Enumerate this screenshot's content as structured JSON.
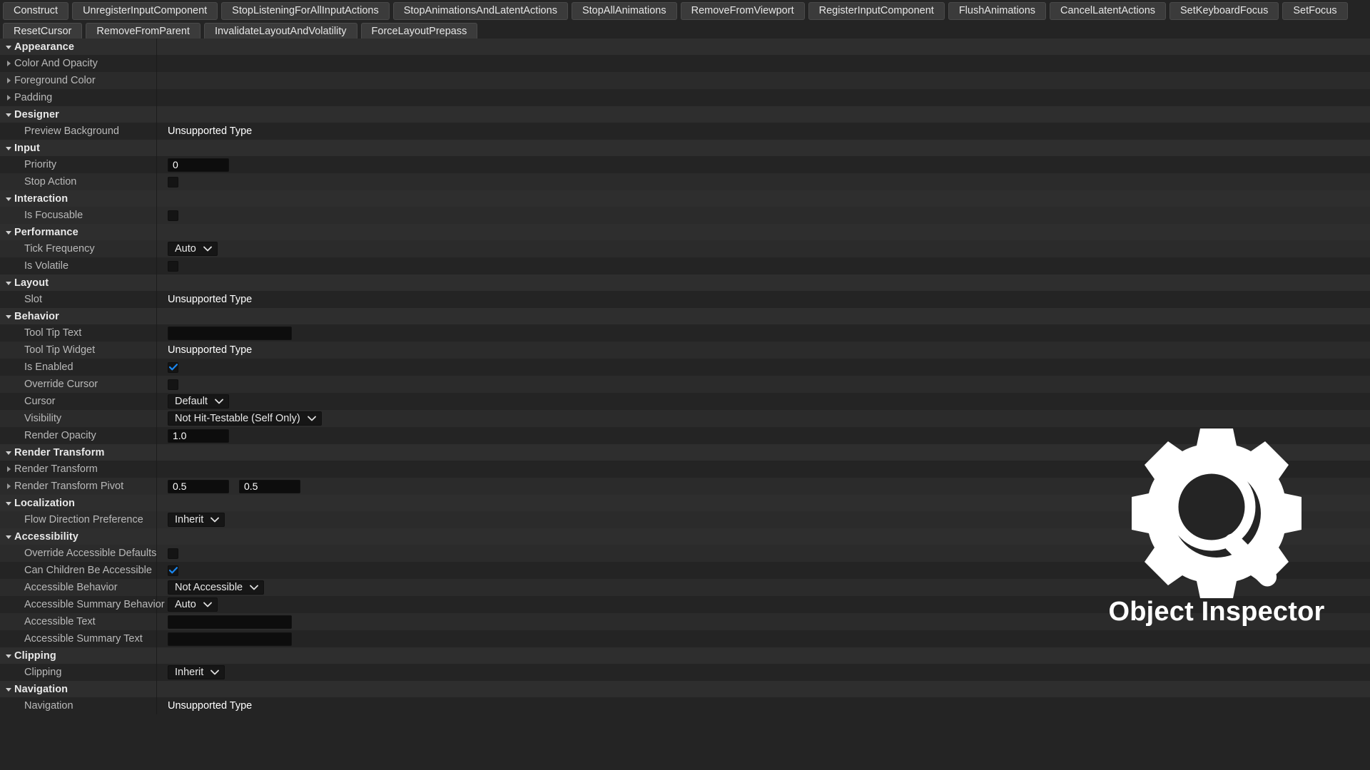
{
  "toolbar": {
    "buttons": [
      "Construct",
      "UnregisterInputComponent",
      "StopListeningForAllInputActions",
      "StopAnimationsAndLatentActions",
      "StopAllAnimations",
      "RemoveFromViewport",
      "RegisterInputComponent",
      "FlushAnimations",
      "CancelLatentActions",
      "SetKeyboardFocus",
      "SetFocus",
      "ResetCursor",
      "RemoveFromParent",
      "InvalidateLayoutAndVolatility",
      "ForceLayoutPrepass"
    ]
  },
  "watermark": {
    "title": "Object Inspector",
    "gear_icon": "gear-icon",
    "magnifier_icon": "magnifier-icon",
    "color": "#ffffff"
  },
  "unsupported_text": "Unsupported Type",
  "properties": [
    {
      "kind": "category",
      "label": "Appearance",
      "expanded": true
    },
    {
      "kind": "property",
      "label": "Color And Opacity",
      "expandable": true,
      "widget": "none"
    },
    {
      "kind": "property",
      "label": "Foreground Color",
      "expandable": true,
      "widget": "none"
    },
    {
      "kind": "property",
      "label": "Padding",
      "expandable": true,
      "widget": "none"
    },
    {
      "kind": "category",
      "label": "Designer",
      "expanded": true
    },
    {
      "kind": "property",
      "label": "Preview Background",
      "expandable": false,
      "widget": "unsupported",
      "value": "Unsupported Type"
    },
    {
      "kind": "category",
      "label": "Input",
      "expanded": true
    },
    {
      "kind": "property",
      "label": "Priority",
      "expandable": false,
      "widget": "number",
      "value": "0"
    },
    {
      "kind": "property",
      "label": "Stop Action",
      "expandable": false,
      "widget": "checkbox",
      "checked": false
    },
    {
      "kind": "category",
      "label": "Interaction",
      "expanded": true
    },
    {
      "kind": "property",
      "label": "Is Focusable",
      "expandable": false,
      "widget": "checkbox",
      "checked": false
    },
    {
      "kind": "category",
      "label": "Performance",
      "expanded": true
    },
    {
      "kind": "property",
      "label": "Tick Frequency",
      "expandable": false,
      "widget": "dropdown",
      "value": "Auto"
    },
    {
      "kind": "property",
      "label": "Is Volatile",
      "expandable": false,
      "widget": "checkbox",
      "checked": false
    },
    {
      "kind": "category",
      "label": "Layout",
      "expanded": true
    },
    {
      "kind": "property",
      "label": "Slot",
      "expandable": false,
      "widget": "unsupported",
      "value": "Unsupported Type"
    },
    {
      "kind": "category",
      "label": "Behavior",
      "expanded": true
    },
    {
      "kind": "property",
      "label": "Tool Tip Text",
      "expandable": false,
      "widget": "text",
      "value": ""
    },
    {
      "kind": "property",
      "label": "Tool Tip Widget",
      "expandable": false,
      "widget": "unsupported",
      "value": "Unsupported Type"
    },
    {
      "kind": "property",
      "label": "Is Enabled",
      "expandable": false,
      "widget": "checkbox",
      "checked": true
    },
    {
      "kind": "property",
      "label": "Override Cursor",
      "expandable": false,
      "widget": "checkbox",
      "checked": false
    },
    {
      "kind": "property",
      "label": "Cursor",
      "expandable": false,
      "widget": "dropdown",
      "value": "Default"
    },
    {
      "kind": "property",
      "label": "Visibility",
      "expandable": false,
      "widget": "dropdown",
      "value": "Not Hit-Testable (Self Only)"
    },
    {
      "kind": "property",
      "label": "Render Opacity",
      "expandable": false,
      "widget": "number",
      "value": "1.0"
    },
    {
      "kind": "category",
      "label": "Render Transform",
      "expanded": true
    },
    {
      "kind": "property",
      "label": "Render Transform",
      "expandable": true,
      "widget": "none"
    },
    {
      "kind": "property",
      "label": "Render Transform Pivot",
      "expandable": true,
      "widget": "number2",
      "value": "0.5",
      "value2": "0.5"
    },
    {
      "kind": "category",
      "label": "Localization",
      "expanded": true
    },
    {
      "kind": "property",
      "label": "Flow Direction Preference",
      "expandable": false,
      "widget": "dropdown",
      "value": "Inherit"
    },
    {
      "kind": "category",
      "label": "Accessibility",
      "expanded": true
    },
    {
      "kind": "property",
      "label": "Override Accessible Defaults",
      "expandable": false,
      "widget": "checkbox",
      "checked": false
    },
    {
      "kind": "property",
      "label": "Can Children Be Accessible",
      "expandable": false,
      "widget": "checkbox",
      "checked": true
    },
    {
      "kind": "property",
      "label": "Accessible Behavior",
      "expandable": false,
      "widget": "dropdown",
      "value": "Not Accessible"
    },
    {
      "kind": "property",
      "label": "Accessible Summary Behavior",
      "expandable": false,
      "widget": "dropdown",
      "value": "Auto"
    },
    {
      "kind": "property",
      "label": "Accessible Text",
      "expandable": false,
      "widget": "text",
      "value": ""
    },
    {
      "kind": "property",
      "label": "Accessible Summary Text",
      "expandable": false,
      "widget": "text",
      "value": ""
    },
    {
      "kind": "category",
      "label": "Clipping",
      "expanded": true
    },
    {
      "kind": "property",
      "label": "Clipping",
      "expandable": false,
      "widget": "dropdown",
      "value": "Inherit"
    },
    {
      "kind": "category",
      "label": "Navigation",
      "expanded": true
    },
    {
      "kind": "property",
      "label": "Navigation",
      "expandable": false,
      "widget": "unsupported",
      "value": "Unsupported Type"
    }
  ]
}
